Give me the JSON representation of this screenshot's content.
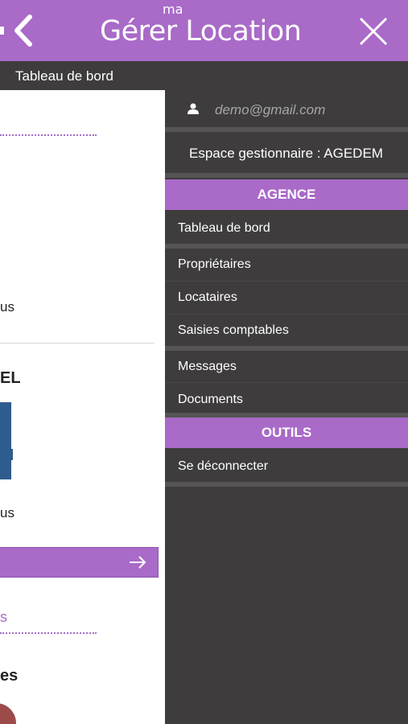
{
  "header": {
    "logo": "Gérer Location",
    "logo_ma": "ma"
  },
  "subheader": {
    "title": "Tableau de bord"
  },
  "content": {
    "partial_text_1": "us",
    "partial_heading": "EL",
    "partial_text_2": "us",
    "partial_link": "s",
    "partial_heading_2": "es"
  },
  "drawer": {
    "user_email": "demo@gmail.com",
    "workspace": "Espace gestionnaire : AGEDEM",
    "sections": [
      {
        "title": "AGENCE",
        "items": [
          "Tableau de bord",
          "Propriétaires",
          "Locataires",
          "Saisies comptables",
          "Messages",
          "Documents"
        ]
      },
      {
        "title": "OUTILS",
        "items": [
          "Se déconnecter"
        ]
      }
    ]
  },
  "colors": {
    "accent": "#a96ac8",
    "drawer_bg": "#3e3c3c",
    "separator": "#565454",
    "email_text": "#a7a7a7"
  },
  "icons": {
    "back": "chevron-left-icon",
    "close": "close-icon",
    "user": "user-icon",
    "arrow": "arrow-right-icon",
    "big_number": "number-four-graphic"
  }
}
